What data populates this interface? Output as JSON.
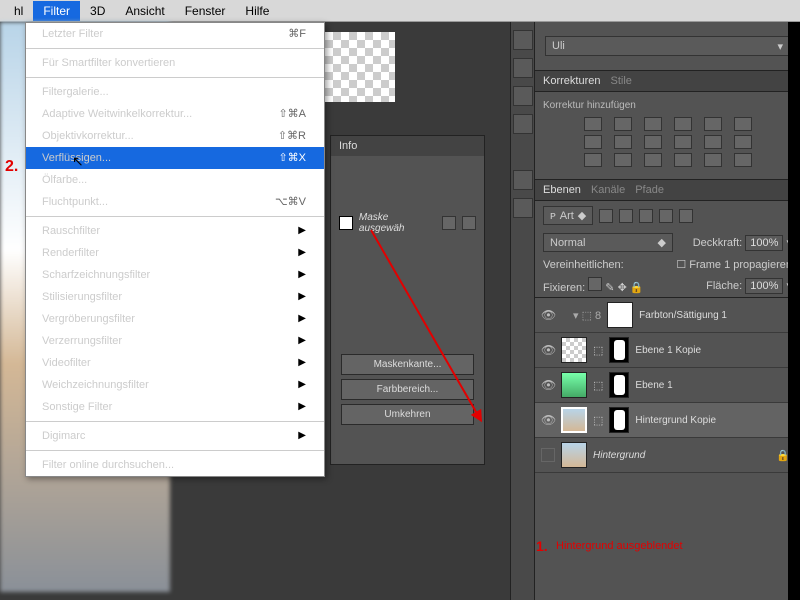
{
  "menubar": {
    "items": [
      "hl",
      "Filter",
      "3D",
      "Ansicht",
      "Fenster",
      "Hilfe"
    ],
    "active": 1
  },
  "dropdown": {
    "last": "Letzter Filter",
    "last_sc": "⌘F",
    "smart": "Für Smartfilter konvertieren",
    "g1": [
      {
        "l": "Filtergalerie...",
        "sc": ""
      },
      {
        "l": "Adaptive Weitwinkelkorrektur...",
        "sc": "⇧⌘A"
      },
      {
        "l": "Objektivkorrektur...",
        "sc": "⇧⌘R"
      },
      {
        "l": "Verflüssigen...",
        "sc": "⇧⌘X",
        "sel": true
      },
      {
        "l": "Ölfarbe...",
        "sc": ""
      },
      {
        "l": "Fluchtpunkt...",
        "sc": "⌥⌘V"
      }
    ],
    "g2": [
      "Rauschfilter",
      "Renderfilter",
      "Scharfzeichnungsfilter",
      "Stilisierungsfilter",
      "Vergröberungsfilter",
      "Verzerrungsfilter",
      "Videofilter",
      "Weichzeichnungsfilter",
      "Sonstige Filter"
    ],
    "g3": "Digimarc",
    "g4": "Filter online durchsuchen..."
  },
  "info": {
    "tab": "Info",
    "mask": "Maske ausgewäh",
    "b1": "Maskenkante...",
    "b2": "Farbbereich...",
    "b3": "Umkehren"
  },
  "user": "Uli",
  "adjust": {
    "t1": "Korrekturen",
    "t2": "Stile",
    "add": "Korrektur hinzufügen"
  },
  "layers": {
    "t1": "Ebenen",
    "t2": "Kanäle",
    "t3": "Pfade",
    "kind": "Art",
    "mode": "Normal",
    "op_l": "Deckkraft:",
    "op_v": "100%",
    "unify": "Vereinheitlichen:",
    "frame": "Frame 1 propagieren",
    "lock": "Fixieren:",
    "fill_l": "Fläche:",
    "fill_v": "100%",
    "items": [
      {
        "name": "Farbton/Sättigung 1",
        "type": "adj"
      },
      {
        "name": "Ebene 1 Kopie",
        "type": "masked"
      },
      {
        "name": "Ebene 1",
        "type": "masked"
      },
      {
        "name": "Hintergrund Kopie",
        "type": "masked",
        "sel": true
      },
      {
        "name": "Hintergrund",
        "type": "bg",
        "locked": true,
        "hidden": true
      }
    ]
  },
  "anno": {
    "n1": "1.",
    "t1": "Hintergrund ausgeblendet",
    "n2": "2."
  }
}
